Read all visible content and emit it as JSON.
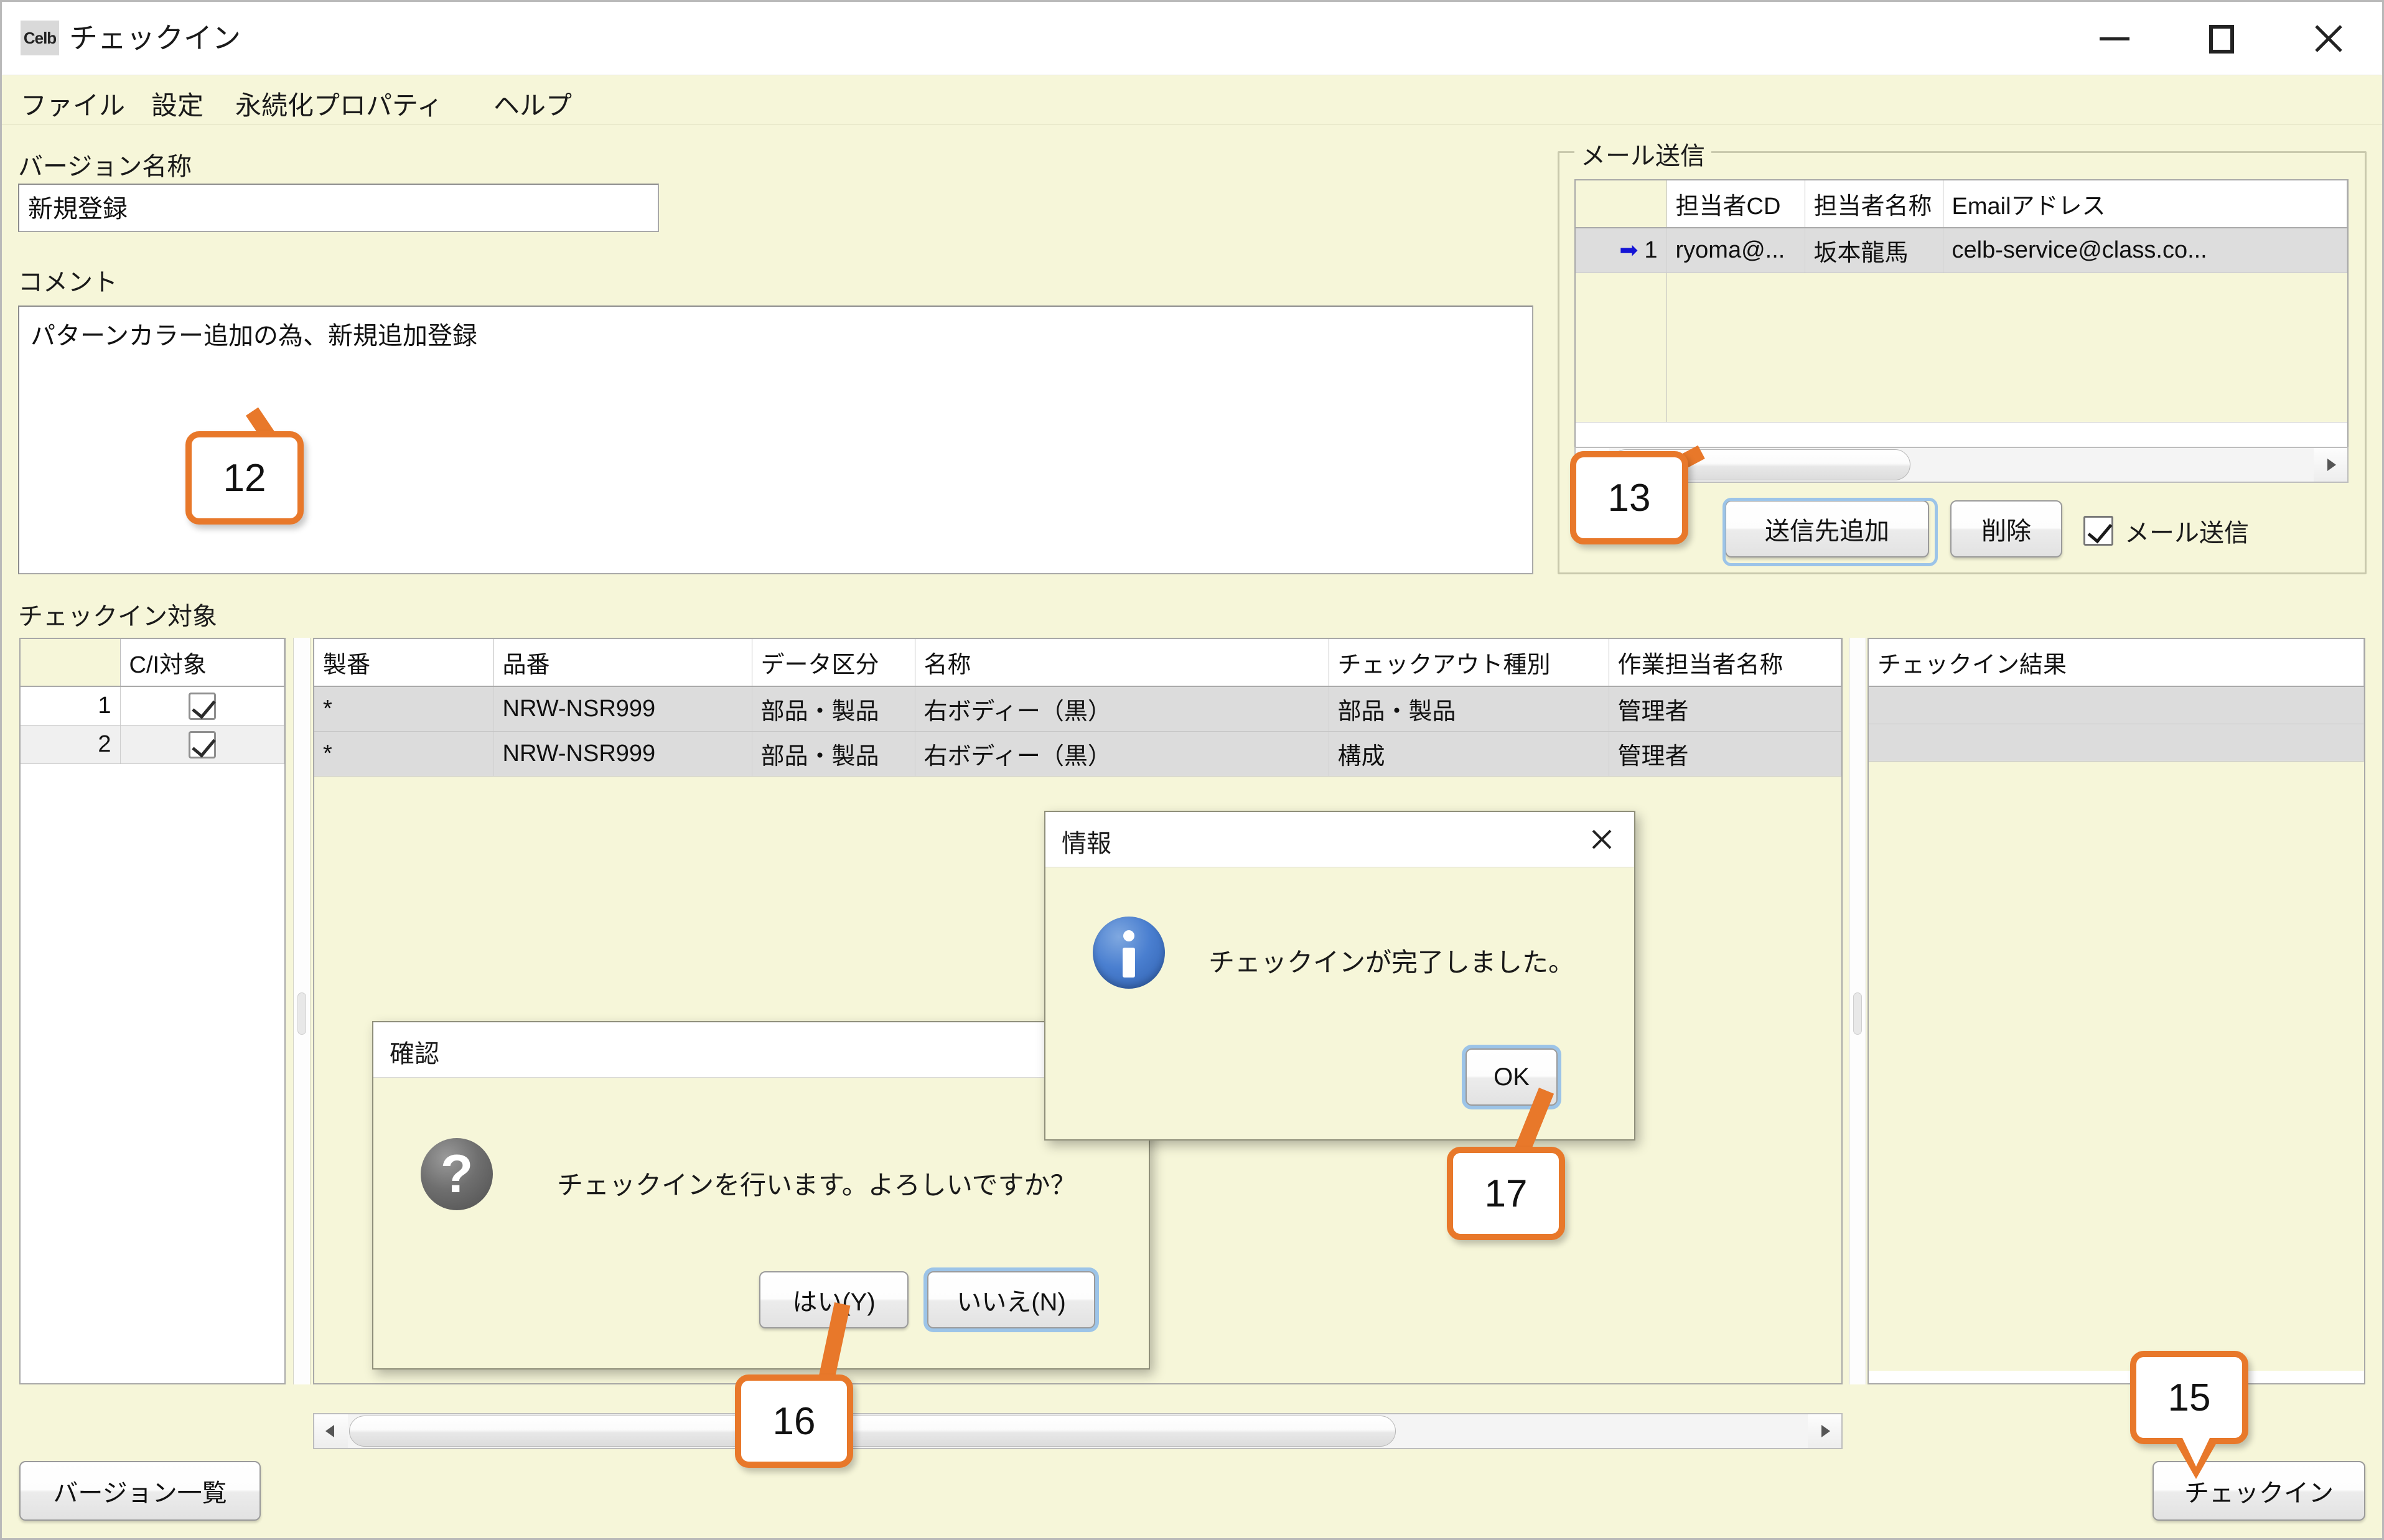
{
  "window": {
    "app_icon_text": "Celb",
    "title": "チェックイン",
    "minimize": "minimize-icon",
    "maximize": "maximize-icon",
    "close": "close-icon"
  },
  "menu": {
    "items": [
      {
        "label": "ファイル"
      },
      {
        "label": "設定"
      },
      {
        "label": "永続化プロパティ"
      },
      {
        "label": "ヘルプ"
      }
    ]
  },
  "version_section": {
    "label": "バージョン名称",
    "value": "新規登録",
    "placeholder": ""
  },
  "comment_section": {
    "label": "コメント",
    "value": "パターンカラー追加の為、新規追加登録",
    "placeholder": ""
  },
  "mail_group": {
    "title": "メール送信",
    "columns": [
      "",
      "担当者CD",
      "担当者名称",
      "Emailアドレス"
    ],
    "rows": [
      {
        "marker": "➡",
        "num": "1",
        "cd": "ryoma@...",
        "name": "坂本龍馬",
        "email": "celb-service@class.co..."
      }
    ],
    "add_button": "送信先追加",
    "delete_button": "削除",
    "send_checkbox_label": "メール送信",
    "send_checkbox_checked": "true"
  },
  "checkin_target": {
    "label": "チェックイン対象",
    "left_columns": [
      "",
      "C/I対象"
    ],
    "left_rows": [
      {
        "num": "1",
        "checked": "true"
      },
      {
        "num": "2",
        "checked": "true"
      }
    ],
    "main_columns": [
      "製番",
      "品番",
      "データ区分",
      "名称",
      "チェックアウト種別",
      "作業担当者名称"
    ],
    "main_rows": [
      {
        "seiban": "*",
        "hinban": "NRW-NSR999",
        "kubun": "部品・製品",
        "meisho": "右ボディー（黒）",
        "checkout": "部品・製品",
        "tantou": "管理者"
      },
      {
        "seiban": "*",
        "hinban": "NRW-NSR999",
        "kubun": "部品・製品",
        "meisho": "右ボディー（黒）",
        "checkout": "構成",
        "tantou": "管理者"
      }
    ],
    "result_column": "チェックイン結果",
    "result_rows": [
      "",
      ""
    ]
  },
  "footer": {
    "version_list_button": "バージョン一覧",
    "checkin_button": "チェックイン"
  },
  "confirm_dialog": {
    "title": "確認",
    "message": "チェックインを行います。よろしいですか？",
    "icon": "question-icon",
    "yes_button": "はい(Y)",
    "no_button": "いいえ(N)"
  },
  "info_dialog": {
    "title": "情報",
    "message": "チェックインが完了しました。",
    "icon": "info-icon",
    "close": "close-icon",
    "ok_button": "OK"
  },
  "callouts": [
    {
      "id": "12",
      "label": "12"
    },
    {
      "id": "13",
      "label": "13"
    },
    {
      "id": "15",
      "label": "15"
    },
    {
      "id": "16",
      "label": "16"
    },
    {
      "id": "17",
      "label": "17"
    }
  ],
  "colors": {
    "window_bg": "#f6f6d9",
    "callout_accent": "#e8782a",
    "focus_ring": "#9cc4e8",
    "marker_blue": "#1414d6"
  }
}
